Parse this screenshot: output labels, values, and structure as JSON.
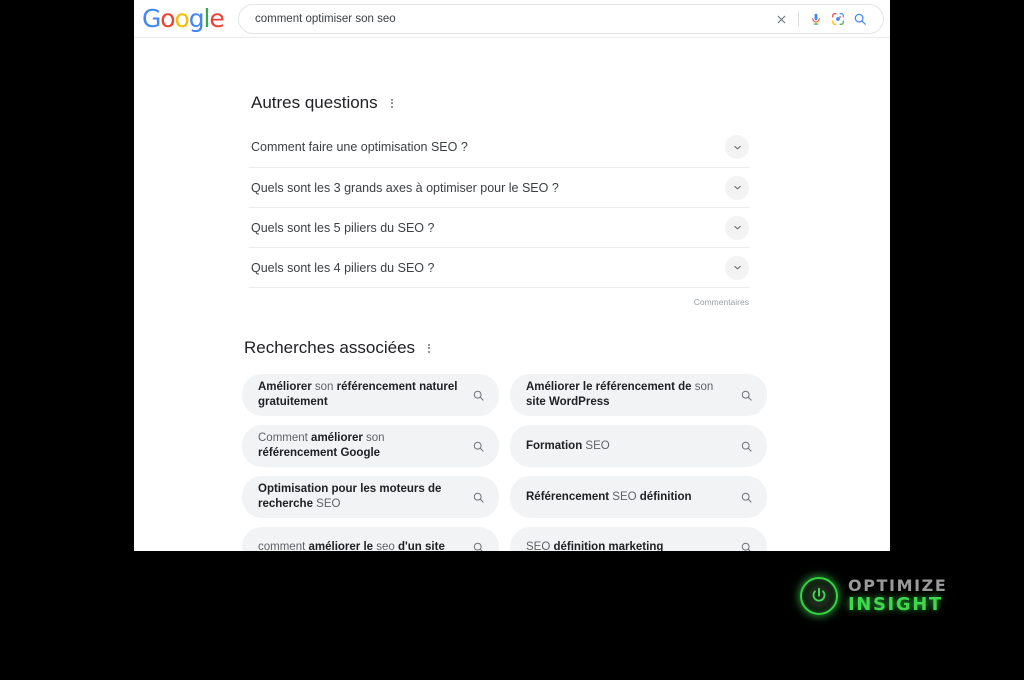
{
  "browser": {
    "logo": {
      "letters": [
        {
          "char": "G",
          "color": "#4285F4"
        },
        {
          "char": "o",
          "color": "#EA4335"
        },
        {
          "char": "o",
          "color": "#FBBC05"
        },
        {
          "char": "g",
          "color": "#4285F4"
        },
        {
          "char": "l",
          "color": "#34A853"
        },
        {
          "char": "e",
          "color": "#EA4335"
        }
      ]
    },
    "search": {
      "value": "comment optimiser son seo",
      "placeholder": "Rechercher",
      "clear_icon": "close-icon",
      "voice_icon": "microphone-icon",
      "lens_icon": "google-lens-icon",
      "submit_icon": "search-icon"
    }
  },
  "people_also_ask": {
    "title": "Autres questions",
    "menu_icon": "more-options-icon",
    "questions": [
      {
        "text": "Comment faire une optimisation SEO ?"
      },
      {
        "text": "Quels sont les 3 grands axes à optimiser pour le SEO ?"
      },
      {
        "text": "Quels sont les 5 piliers du SEO ?"
      },
      {
        "text": "Quels sont les 4 piliers du SEO ?"
      }
    ],
    "feedback_label": "Commentaires"
  },
  "related_searches": {
    "title": "Recherches associées",
    "menu_icon": "more-options-icon",
    "icon": "search-icon",
    "items": [
      {
        "parts": [
          {
            "t": "Améliorer",
            "bold": true
          },
          {
            "t": " son ",
            "bold": false
          },
          {
            "t": "référencement naturel gratuitement",
            "bold": true
          }
        ]
      },
      {
        "parts": [
          {
            "t": "Améliorer le référencement de",
            "bold": true
          },
          {
            "t": " son ",
            "bold": false
          },
          {
            "t": "site WordPress",
            "bold": true
          }
        ]
      },
      {
        "parts": [
          {
            "t": "Comment ",
            "bold": false
          },
          {
            "t": "améliorer",
            "bold": true
          },
          {
            "t": " son ",
            "bold": false
          },
          {
            "t": "référencement Google",
            "bold": true
          }
        ]
      },
      {
        "parts": [
          {
            "t": "Formation",
            "bold": true
          },
          {
            "t": " SEO",
            "bold": false
          }
        ]
      },
      {
        "parts": [
          {
            "t": "Optimisation pour les moteurs de recherche",
            "bold": true
          },
          {
            "t": " SEO",
            "bold": false
          }
        ]
      },
      {
        "parts": [
          {
            "t": "Référencement",
            "bold": true
          },
          {
            "t": " SEO ",
            "bold": false
          },
          {
            "t": "définition",
            "bold": true
          }
        ]
      },
      {
        "parts": [
          {
            "t": "comment ",
            "bold": false
          },
          {
            "t": "améliorer le",
            "bold": true
          },
          {
            "t": " seo ",
            "bold": false
          },
          {
            "t": "d'un site",
            "bold": true
          }
        ]
      },
      {
        "parts": [
          {
            "t": "SEO ",
            "bold": false
          },
          {
            "t": "définition marketing",
            "bold": true
          }
        ]
      }
    ]
  },
  "watermark": {
    "line1": "OPTIMIZE",
    "line2": "INSIGHT",
    "icon": "power-button-icon",
    "accent_color": "#3fd94f"
  }
}
